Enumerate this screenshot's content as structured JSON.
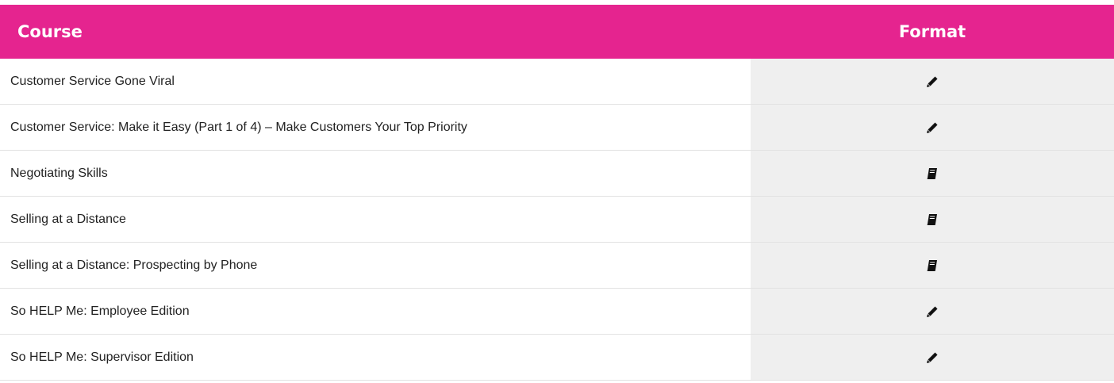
{
  "table": {
    "headers": {
      "course": "Course",
      "format": "Format"
    },
    "rows": [
      {
        "course": "Customer Service Gone Viral",
        "format_icon": "pencil-icon"
      },
      {
        "course": "Customer Service: Make it Easy (Part 1 of 4) – Make Customers Your Top Priority",
        "format_icon": "pencil-icon"
      },
      {
        "course": "Negotiating Skills",
        "format_icon": "book-icon"
      },
      {
        "course": "Selling at a Distance",
        "format_icon": "book-icon"
      },
      {
        "course": "Selling at a Distance: Prospecting by Phone",
        "format_icon": "book-icon"
      },
      {
        "course": "So HELP Me: Employee Edition",
        "format_icon": "pencil-icon"
      },
      {
        "course": "So HELP Me: Supervisor Edition",
        "format_icon": "pencil-icon"
      }
    ]
  },
  "colors": {
    "header_bg": "#e5248f",
    "format_col_bg": "#efefef"
  }
}
